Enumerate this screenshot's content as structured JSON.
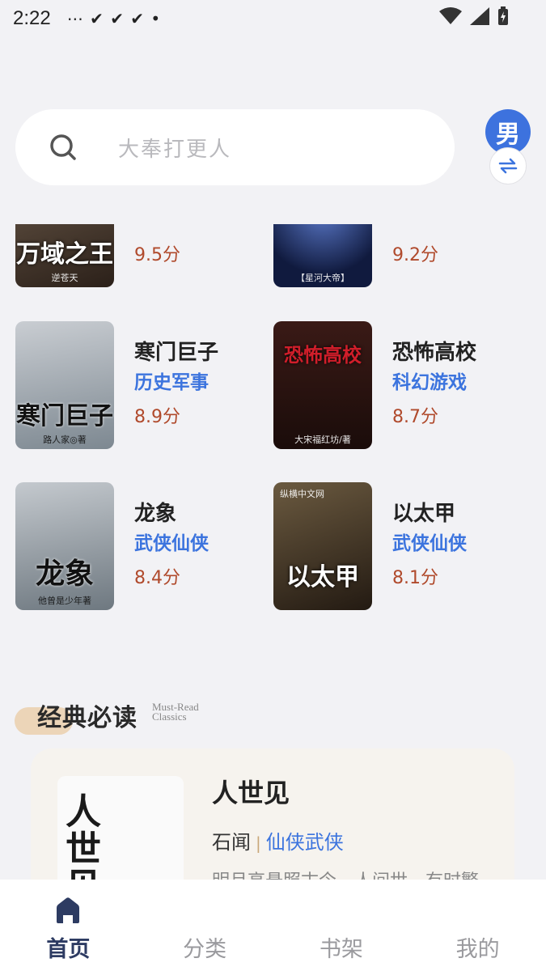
{
  "status": {
    "time": "2:22",
    "notifications": "⋯  ✔  ✔  ✔  •"
  },
  "search": {
    "placeholder": "大奉打更人"
  },
  "gender_toggle": {
    "label": "男"
  },
  "books": [
    {
      "title": "",
      "category": "",
      "score": "9.5分",
      "cover_text": "万域之王",
      "cover_author": "逆苍天",
      "cover_color": "#3c2f28"
    },
    {
      "title": "",
      "category": "",
      "score": "9.2分",
      "cover_text": "",
      "cover_author": "【星河大帝】",
      "cover_color": "#1b2a5e"
    },
    {
      "title": "寒门巨子",
      "category": "历史军事",
      "score": "8.9分",
      "cover_text": "寒门巨子",
      "cover_author": "路人家◎著",
      "cover_color": "#8e9aa4"
    },
    {
      "title": "恐怖高校",
      "category": "科幻游戏",
      "score": "8.7分",
      "cover_text": "恐怖高校",
      "cover_author": "大宋福红坊/著",
      "cover_color": "#2a1713"
    },
    {
      "title": "龙象",
      "category": "武侠仙侠",
      "score": "8.4分",
      "cover_text": "龙象",
      "cover_author": "他曾是少年著",
      "cover_color": "#8f979f"
    },
    {
      "title": "以太甲",
      "category": "武侠仙侠",
      "score": "8.1分",
      "cover_text": "以太甲",
      "cover_author": "纵横中文网",
      "cover_color": "#4a3b2a"
    }
  ],
  "classics": {
    "heading": "经典必读",
    "heading_en": "Must-Read Classics",
    "card": {
      "title": "人世见",
      "author": "石闻",
      "category": "仙侠武侠",
      "description": "明月高悬照古今，人间世，有时繁",
      "cover_text": "人世见"
    }
  },
  "tabs": [
    {
      "label": "首页",
      "active": true
    },
    {
      "label": "分类",
      "active": false
    },
    {
      "label": "书架",
      "active": false
    },
    {
      "label": "我的",
      "active": false
    }
  ],
  "colors": {
    "accent": "#3c74de",
    "score": "#b04a2c",
    "active_tab": "#2d3b62"
  }
}
